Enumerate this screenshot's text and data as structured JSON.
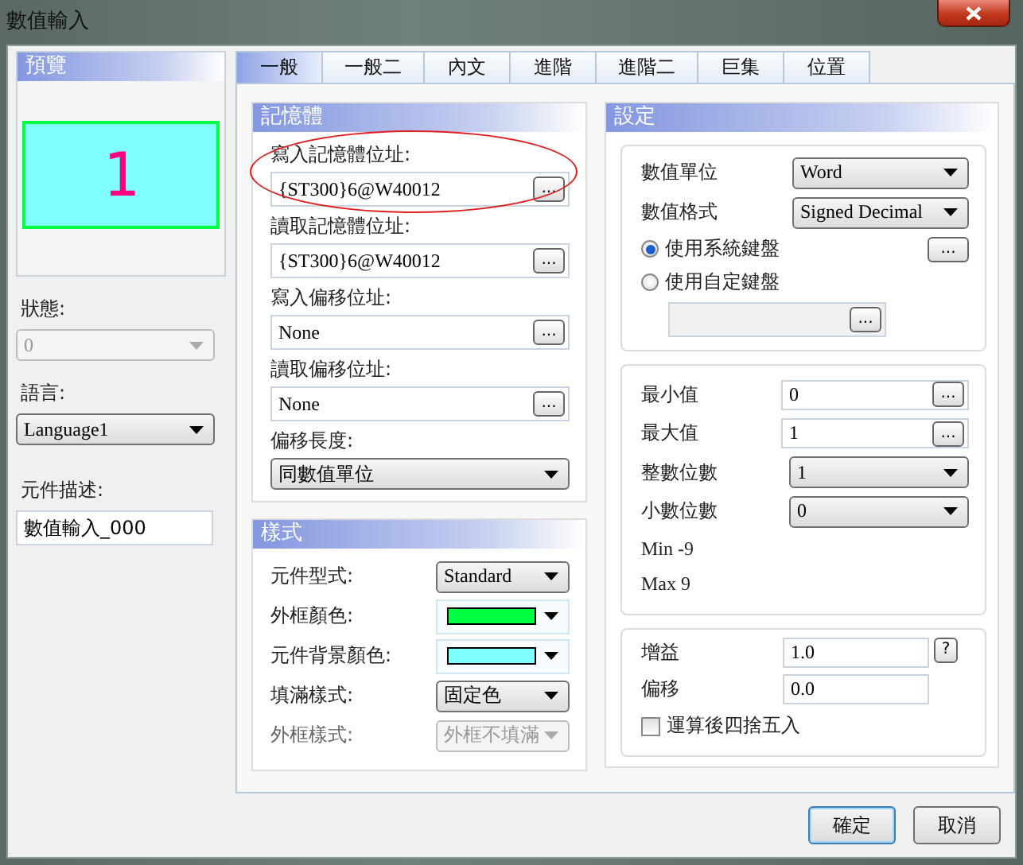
{
  "window": {
    "title": "數值輸入"
  },
  "preview": {
    "title": "預覽",
    "value": "1"
  },
  "state_field": {
    "label": "狀態:",
    "value": "0",
    "disabled": true
  },
  "language_field": {
    "label": "語言:",
    "value": "Language1",
    "disabled": false
  },
  "description_field": {
    "label": "元件描述:",
    "value": "數值輸入_000"
  },
  "tabs": [
    {
      "label": "一般",
      "selected": true
    },
    {
      "label": "一般二",
      "selected": false
    },
    {
      "label": "內文",
      "selected": false
    },
    {
      "label": "進階",
      "selected": false
    },
    {
      "label": "進階二",
      "selected": false
    },
    {
      "label": "巨集",
      "selected": false
    },
    {
      "label": "位置",
      "selected": false
    }
  ],
  "memory": {
    "title": "記憶體",
    "fields": [
      {
        "label": "寫入記憶體位址:",
        "kind": "address",
        "value": "{ST300}6@W40012",
        "browse": "...",
        "highlighted": true
      },
      {
        "label": "讀取記憶體位址:",
        "kind": "address",
        "value": "{ST300}6@W40012",
        "browse": "...",
        "highlighted": false
      },
      {
        "label": "寫入偏移位址:",
        "kind": "address",
        "value": "None",
        "browse": "...",
        "highlighted": false
      },
      {
        "label": "讀取偏移位址:",
        "kind": "address",
        "value": "None",
        "browse": "...",
        "highlighted": false
      },
      {
        "label": "偏移長度:",
        "kind": "dropdown",
        "value": "同數值單位",
        "highlighted": false
      }
    ]
  },
  "style": {
    "title": "樣式",
    "rows": [
      {
        "label": "元件型式:",
        "kind": "dropdown",
        "value": "Standard",
        "disabled": false
      },
      {
        "label": "外框顏色:",
        "kind": "swatch",
        "color": "#00ff40",
        "disabled": false
      },
      {
        "label": "元件背景顏色:",
        "kind": "swatch",
        "color": "#80ffff",
        "disabled": false
      },
      {
        "label": "填滿樣式:",
        "kind": "dropdown",
        "value": "固定色",
        "disabled": false
      },
      {
        "label": "外框樣式:",
        "kind": "dropdown",
        "value": "外框不填滿",
        "disabled": true
      }
    ]
  },
  "settings": {
    "title": "設定",
    "format": [
      {
        "label": "數值單位",
        "value": "Word"
      },
      {
        "label": "數值格式",
        "value": "Signed Decimal"
      }
    ],
    "keyboard": [
      {
        "label": "使用系統鍵盤",
        "selected": true,
        "browse": "..."
      },
      {
        "label": "使用自定鍵盤",
        "selected": false
      }
    ],
    "custom_keyboard": {
      "browse": "..."
    },
    "limits": [
      {
        "label": "最小值",
        "kind": "input",
        "value": "0",
        "browse": "..."
      },
      {
        "label": "最大值",
        "kind": "input",
        "value": "1",
        "browse": "..."
      },
      {
        "label": "整數位數",
        "kind": "dropdown",
        "value": "1"
      },
      {
        "label": "小數位數",
        "kind": "dropdown",
        "value": "0"
      }
    ],
    "range": [
      "Min -9",
      "Max 9"
    ],
    "scaling": [
      {
        "label": "增益",
        "value": "1.0",
        "help": "?"
      },
      {
        "label": "偏移",
        "value": "0.0"
      }
    ],
    "round_after": {
      "label": "運算後四捨五入",
      "checked": false
    }
  },
  "buttons": [
    {
      "label": "確定",
      "default": true
    },
    {
      "label": "取消",
      "default": false
    }
  ]
}
